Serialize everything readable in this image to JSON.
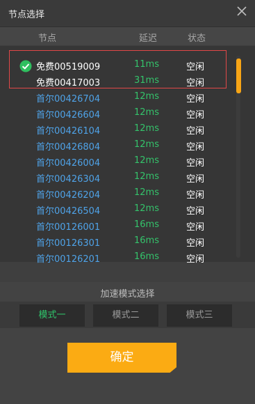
{
  "window": {
    "title": "节点选择"
  },
  "header": {
    "col_node": "节点",
    "col_latency": "延迟",
    "col_status": "状态"
  },
  "rows": [
    {
      "node": "免费00519009",
      "latency": "11ms",
      "status": "空闲",
      "free": true,
      "selected": true
    },
    {
      "node": "免费00417003",
      "latency": "31ms",
      "status": "空闲",
      "free": true,
      "selected": false
    },
    {
      "node": "首尔00426704",
      "latency": "12ms",
      "status": "空闲",
      "free": false
    },
    {
      "node": "首尔00426604",
      "latency": "12ms",
      "status": "空闲",
      "free": false
    },
    {
      "node": "首尔00426104",
      "latency": "12ms",
      "status": "空闲",
      "free": false
    },
    {
      "node": "首尔00426804",
      "latency": "12ms",
      "status": "空闲",
      "free": false
    },
    {
      "node": "首尔00426004",
      "latency": "12ms",
      "status": "空闲",
      "free": false
    },
    {
      "node": "首尔00426304",
      "latency": "12ms",
      "status": "空闲",
      "free": false
    },
    {
      "node": "首尔00426204",
      "latency": "12ms",
      "status": "空闲",
      "free": false
    },
    {
      "node": "首尔00426504",
      "latency": "12ms",
      "status": "空闲",
      "free": false
    },
    {
      "node": "首尔00126001",
      "latency": "16ms",
      "status": "空闲",
      "free": false
    },
    {
      "node": "首尔00126301",
      "latency": "16ms",
      "status": "空闲",
      "free": false
    },
    {
      "node": "首尔00126201",
      "latency": "16ms",
      "status": "空闲",
      "free": false
    }
  ],
  "mode": {
    "title": "加速模式选择",
    "options": [
      {
        "label": "模式一",
        "active": true
      },
      {
        "label": "模式二",
        "active": false
      },
      {
        "label": "模式三",
        "active": false
      }
    ]
  },
  "confirm_label": "确定",
  "colors": {
    "accent": "#fbab13",
    "latency_green": "#34c36b",
    "node_blue": "#4fa3e8",
    "selection_red": "#e24848"
  },
  "icons": {
    "close": "close-icon",
    "check": "check-circle-icon"
  }
}
